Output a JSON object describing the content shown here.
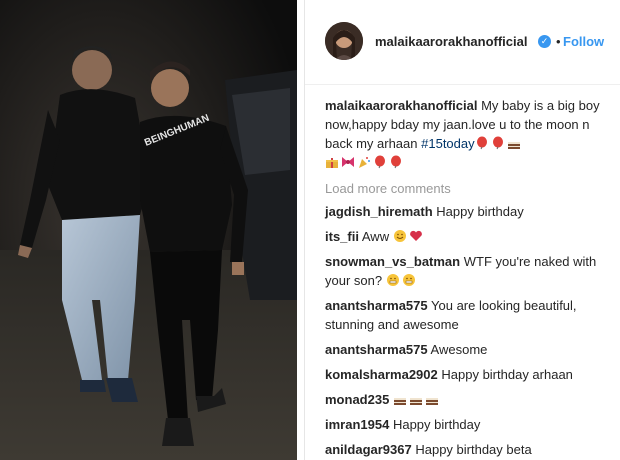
{
  "post": {
    "username": "malaikaarorakhanofficial",
    "follow_label": "Follow",
    "dot": "•",
    "caption": {
      "username": "malaikaarorakhanofficial",
      "text": "My baby is a big boy now,happy bday my jaan.love u to the moon n back my arhaan",
      "hashtag": "#15today"
    },
    "load_more": "Load more comments",
    "comments": [
      {
        "user": "jagdish_hiremath",
        "text": "Happy birthday"
      },
      {
        "user": "its_fii",
        "text": "Aww"
      },
      {
        "user": "snowman_vs_batman",
        "text": "WTF you're naked with your son?"
      },
      {
        "user": "anantsharma575",
        "text": "You are looking beautiful, stunning and awesome"
      },
      {
        "user": "anantsharma575",
        "text": "Awesome"
      },
      {
        "user": "komalsharma2902",
        "text": "Happy birthday arhaan"
      },
      {
        "user": "monad235",
        "text": ""
      },
      {
        "user": "imran1954",
        "text": "Happy birthday"
      },
      {
        "user": "anildagar9367",
        "text": "Happy birthday beta"
      }
    ]
  },
  "photo": {
    "tshirt_text": "BEINGHUMAN"
  },
  "colors": {
    "link": "#3897f0",
    "text": "#262626",
    "muted": "#999999",
    "hashtag": "#003569"
  },
  "icons": [
    "verified-badge-icon",
    "balloon-icon",
    "cake-icon",
    "gift-icon",
    "ribbon-icon",
    "party-popper-icon",
    "grimace-icon",
    "smile-icon",
    "heart-icon"
  ]
}
